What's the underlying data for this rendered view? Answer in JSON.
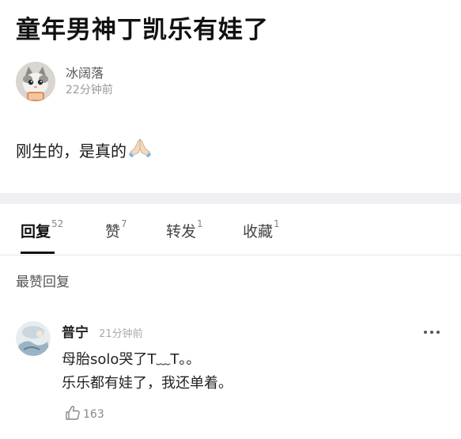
{
  "post": {
    "title": "童年男神丁凯乐有娃了",
    "author": {
      "name": "冰阔落",
      "time": "22分钟前"
    },
    "body": "刚生的，是真的"
  },
  "icons": {
    "post_emoji": "folded-hands-icon",
    "more": "more-dots-icon",
    "like": "thumbs-up-icon"
  },
  "tabs": [
    {
      "label": "回复",
      "count": "52",
      "active": true
    },
    {
      "label": "赞",
      "count": "7"
    },
    {
      "label": "转发",
      "count": "1"
    },
    {
      "label": "收藏",
      "count": "1"
    }
  ],
  "section_heading": "最赞回复",
  "comment": {
    "name": "普宁",
    "time": "21分钟前",
    "line1": "母胎solo哭了T﹏T。。",
    "line2": "乐乐都有娃了，我还单着。",
    "likes": "163"
  },
  "colors": {
    "tab_active": "#111111",
    "divider": "#f0f0f2",
    "muted_text": "#999999"
  }
}
